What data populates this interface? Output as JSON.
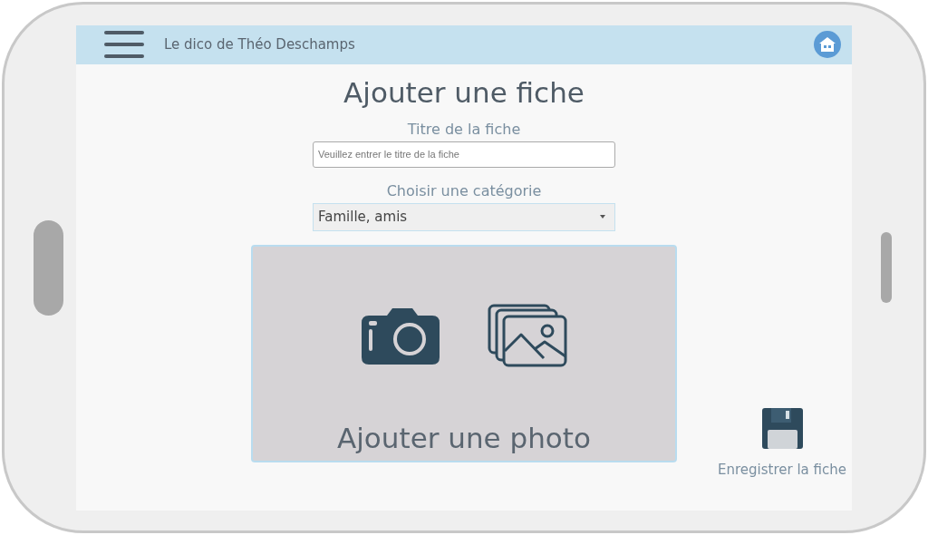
{
  "header": {
    "title": "Le dico de Théo Deschamps"
  },
  "page_title": "Ajouter une fiche",
  "title_field": {
    "label": "Titre de la fiche",
    "placeholder": "Veuillez entrer le titre de la fiche"
  },
  "category_select": {
    "label": "Choisir une catégorie",
    "value": "Famille, amis"
  },
  "photo_area": {
    "label": "Ajouter une photo"
  },
  "save_button": {
    "label": "Enregistrer la fiche"
  }
}
